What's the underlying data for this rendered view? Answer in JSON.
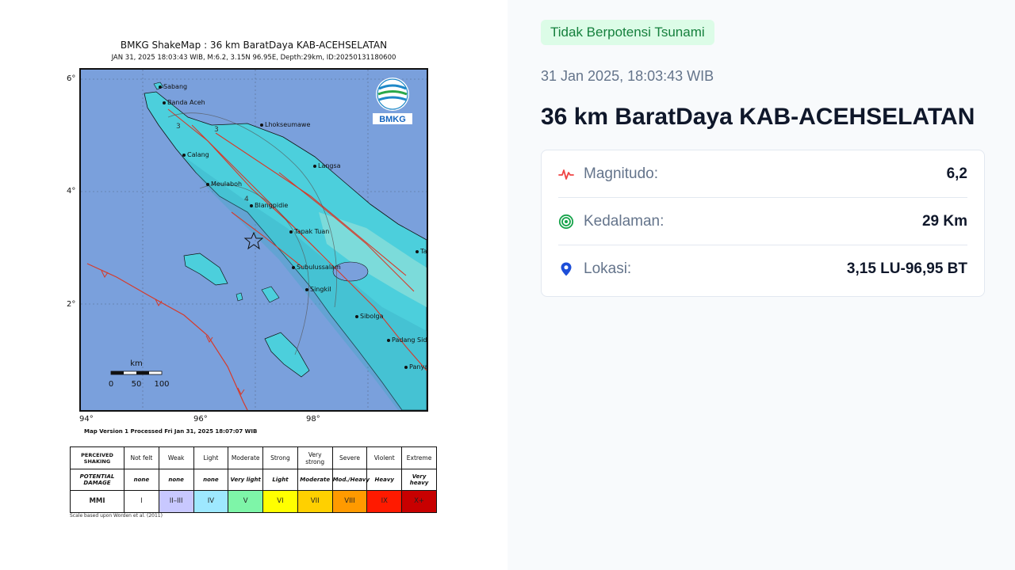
{
  "shakemap": {
    "title": "BMKG ShakeMap : 36 km BaratDaya KAB-ACEHSELATAN",
    "subtitle": "JAN 31, 2025 18:03:43 WIB, M:6.2, 3.15N 96.95E, Depth:29km, ID:20250131180600",
    "lat_ticks": [
      "6°",
      "4°",
      "2°"
    ],
    "lon_ticks": [
      "94°",
      "96°",
      "98°"
    ],
    "cities": [
      "Sabang",
      "Banda Aceh",
      "Lhokseumawe",
      "Calang",
      "Langsa",
      "Meulaboh",
      "Blangpidie",
      "Tapak Tuan",
      "Subulussalam",
      "Singkil",
      "Sibolga",
      "Padang Sid",
      "Panya",
      "Ta"
    ],
    "contour_labels": [
      "3",
      "3",
      "4"
    ],
    "logo_text": "BMKG",
    "scale_bar": {
      "unit": "km",
      "ticks": [
        "0",
        "50",
        "100"
      ]
    },
    "version_note": "Map Version 1 Processed Fri Jan 31, 2025 18:07:07 WIB",
    "colors": {
      "sea": "#7aa0dc",
      "land": "#45c8d8",
      "fault": "#d63a2a"
    }
  },
  "mmi_legend": {
    "row_headers": [
      "PERCEIVED SHAKING",
      "POTENTIAL DAMAGE",
      "MMI"
    ],
    "shaking": [
      "Not felt",
      "Weak",
      "Light",
      "Moderate",
      "Strong",
      "Very strong",
      "Severe",
      "Violent",
      "Extreme"
    ],
    "damage": [
      "none",
      "none",
      "none",
      "Very light",
      "Light",
      "Moderate",
      "Mod./Heavy",
      "Heavy",
      "Very heavy"
    ],
    "mmi": [
      "I",
      "II–III",
      "IV",
      "V",
      "VI",
      "VII",
      "VIII",
      "IX",
      "X+"
    ],
    "colors": [
      "#ffffff",
      "#c8c8ff",
      "#9ee8ff",
      "#7ef5a8",
      "#ffff00",
      "#ffd000",
      "#ff9a00",
      "#ff1a00",
      "#c80000"
    ],
    "scale_note": "Scale based upon Worden et al. (2011)"
  },
  "info": {
    "badge": "Tidak Berpotensi Tsunami",
    "datetime": "31 Jan 2025, 18:03:43 WIB",
    "headline": "36 km BaratDaya KAB-ACEHSELATAN",
    "rows": [
      {
        "label": "Magnitudo:",
        "value": "6,2",
        "icon": "pulse-icon",
        "color": "#ef4444"
      },
      {
        "label": "Kedalaman:",
        "value": "29 Km",
        "icon": "target-icon",
        "color": "#16a34a"
      },
      {
        "label": "Lokasi:",
        "value": "3,15 LU-96,95 BT",
        "icon": "map-pin-icon",
        "color": "#1d4ed8"
      }
    ]
  }
}
